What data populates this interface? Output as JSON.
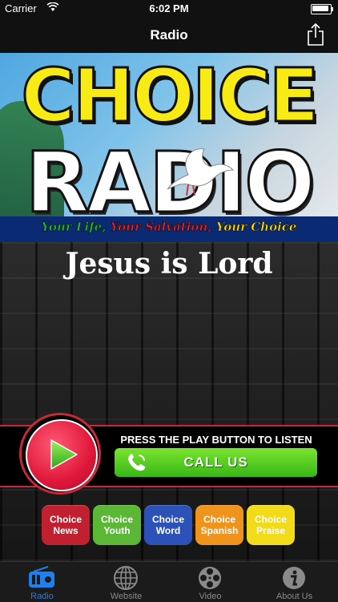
{
  "status_bar": {
    "carrier": "Carrier",
    "time": "6:02 PM"
  },
  "nav": {
    "title": "Radio"
  },
  "banner": {
    "line1": "CHOICE",
    "line2": "RADIO",
    "tagline": [
      "Your Life,",
      "Your Salvation,",
      "Your Choice"
    ],
    "tagline_colors": [
      "#1fb82a",
      "#e52222",
      "#ffd200"
    ]
  },
  "headline": "Jesus is Lord",
  "player": {
    "instruction": "PRESS THE PLAY BUTTON TO LISTEN",
    "call_label": "CALL US"
  },
  "tiles": [
    {
      "line1": "Choice",
      "line2": "News",
      "color": "#c0202f"
    },
    {
      "line1": "Choice",
      "line2": "Youth",
      "color": "#5cb737"
    },
    {
      "line1": "Choice",
      "line2": "Word",
      "color": "#2c52b8"
    },
    {
      "line1": "Choice",
      "line2": "Spanish",
      "color": "#f0931c"
    },
    {
      "line1": "Choice",
      "line2": "Praise",
      "color": "#f2dc19"
    }
  ],
  "tabs": [
    {
      "label": "Radio",
      "icon": "radio-icon",
      "active": true
    },
    {
      "label": "Website",
      "icon": "globe-icon",
      "active": false
    },
    {
      "label": "Video",
      "icon": "film-reel-icon",
      "active": false
    },
    {
      "label": "About Us",
      "icon": "info-icon",
      "active": false
    }
  ],
  "colors": {
    "accent": "#1f7ef0",
    "play": "#e0173b",
    "call": "#4cc21f"
  }
}
